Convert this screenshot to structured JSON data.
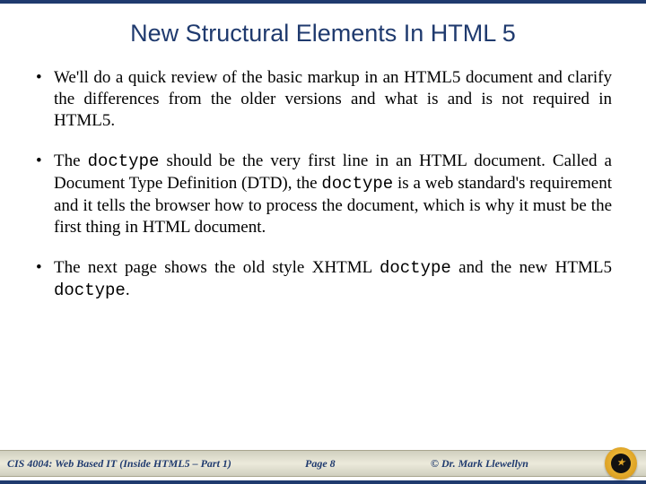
{
  "title": "New Structural Elements In HTML 5",
  "bullets": [
    {
      "segments": [
        {
          "text": "We'll do a quick review of the basic markup in an HTML5 document and clarify the differences from the older versions and what is and is not required in HTML5.",
          "mono": false
        }
      ]
    },
    {
      "segments": [
        {
          "text": "The ",
          "mono": false
        },
        {
          "text": "doctype",
          "mono": true
        },
        {
          "text": " should be the very first line in an HTML document.  Called a Document Type Definition (DTD), the ",
          "mono": false
        },
        {
          "text": "doctype",
          "mono": true
        },
        {
          "text": " is a web standard's requirement and it tells the browser how to process the document, which is why it must be the first thing in HTML document.",
          "mono": false
        }
      ]
    },
    {
      "segments": [
        {
          "text": "The next page shows the old style XHTML ",
          "mono": false
        },
        {
          "text": "doctype",
          "mono": true
        },
        {
          "text": " and the new HTML5 ",
          "mono": false
        },
        {
          "text": "doctype",
          "mono": true
        },
        {
          "text": ".",
          "mono": false
        }
      ]
    }
  ],
  "footer": {
    "course": "CIS 4004: Web Based IT (Inside HTML5 – Part 1)",
    "page": "Page 8",
    "author": "© Dr. Mark Llewellyn"
  }
}
